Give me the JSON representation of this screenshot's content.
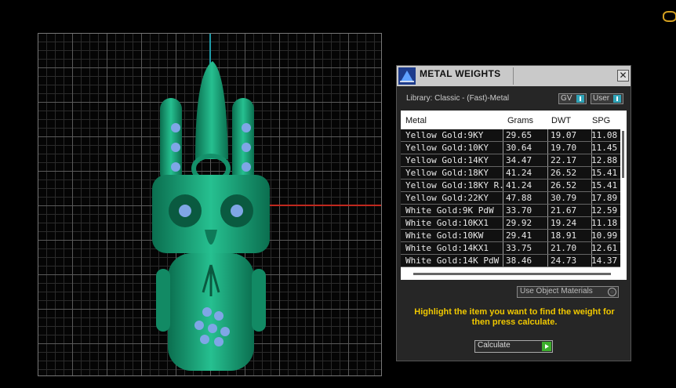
{
  "panel": {
    "title": "METAL WEIGHTS",
    "close_glyph": "✕",
    "library_label": "Library: Classic - (Fast)-Metal",
    "toggles": [
      {
        "label": "GV"
      },
      {
        "label": "User"
      }
    ],
    "columns": [
      "Metal",
      "Grams",
      "DWT",
      "SPG"
    ],
    "rows": [
      [
        "Yellow Gold:9KY",
        "29.65",
        "19.07",
        "11.08"
      ],
      [
        "Yellow Gold:10KY",
        "30.64",
        "19.70",
        "11.45"
      ],
      [
        "Yellow Gold:14KY",
        "34.47",
        "22.17",
        "12.88"
      ],
      [
        "Yellow Gold:18KY",
        "41.24",
        "26.52",
        "15.41"
      ],
      [
        "Yellow Gold:18KY R...",
        "41.24",
        "26.52",
        "15.41"
      ],
      [
        "Yellow Gold:22KY",
        "47.88",
        "30.79",
        "17.89"
      ],
      [
        "White Gold:9K PdW",
        "33.70",
        "21.67",
        "12.59"
      ],
      [
        "White Gold:10KX1",
        "29.92",
        "19.24",
        "11.18"
      ],
      [
        "White Gold:10KW",
        "29.41",
        "18.91",
        "10.99"
      ],
      [
        "White Gold:14KX1",
        "33.75",
        "21.70",
        "12.61"
      ],
      [
        "White Gold:14K PdW",
        "38.46",
        "24.73",
        "14.37"
      ]
    ],
    "use_object_materials": "Use Object Materials",
    "hint": "Highlight the item you want to find the weight for then press calculate.",
    "calculate_label": "Calculate"
  },
  "viewport": {
    "model_color": "#1aa07a",
    "gem_color": "#7fa6e6"
  }
}
